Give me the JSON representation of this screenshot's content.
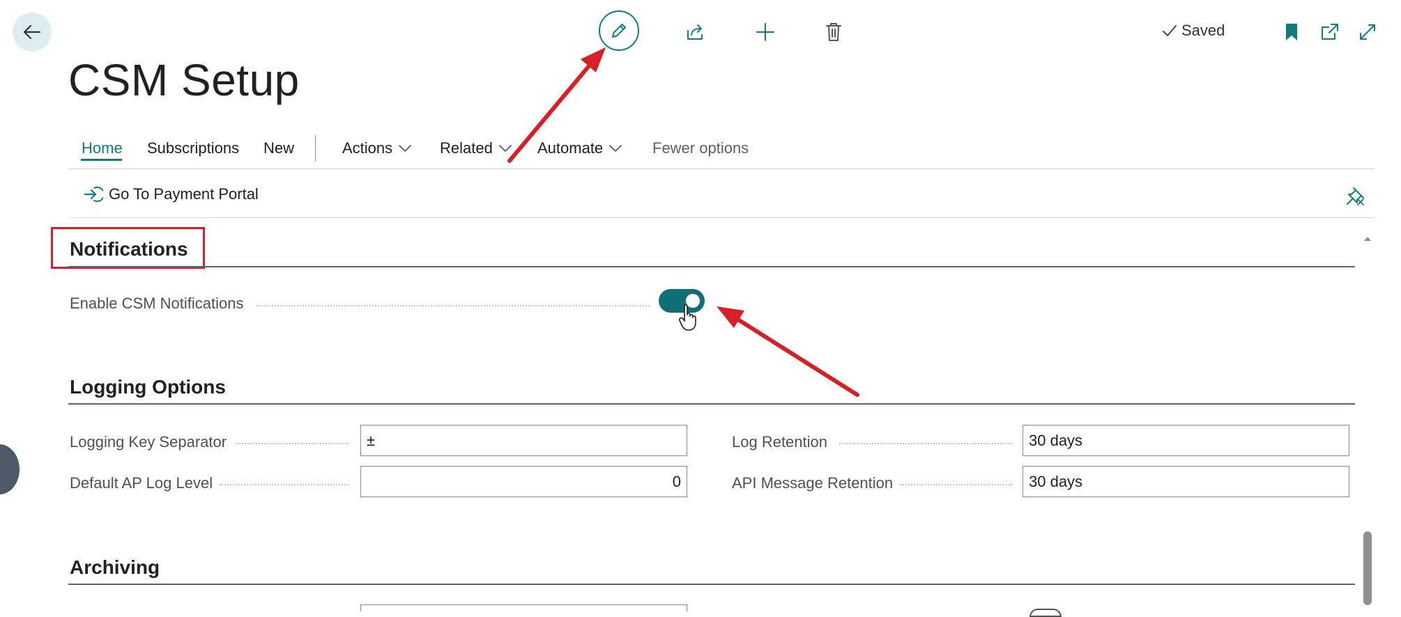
{
  "toolbar": {
    "back_icon": "arrow-left-icon",
    "edit_icon": "pencil-icon",
    "share_icon": "share-icon",
    "new_icon": "plus-icon",
    "delete_icon": "trash-icon",
    "saved_label": "Saved",
    "bookmark_icon": "bookmark-icon",
    "popout_icon": "open-in-new-window-icon",
    "expand_icon": "expand-icon"
  },
  "page": {
    "title": "CSM Setup"
  },
  "nav": {
    "home": "Home",
    "subscriptions": "Subscriptions",
    "new": "New",
    "actions": "Actions",
    "related": "Related",
    "automate": "Automate",
    "fewer_options": "Fewer options"
  },
  "actions_bar": {
    "portal_label": "Go To Payment Portal"
  },
  "sections": {
    "notifications": {
      "title": "Notifications",
      "enable_label": "Enable CSM Notifications",
      "enable_value": true
    },
    "logging": {
      "title": "Logging Options",
      "key_separator_label": "Logging Key Separator",
      "key_separator_value": "±",
      "log_level_label": "Default AP Log Level",
      "log_level_value": "0",
      "log_retention_label": "Log Retention",
      "log_retention_value": "30 days",
      "api_retention_label": "API Message Retention",
      "api_retention_value": "30 days"
    },
    "archiving": {
      "title": "Archiving"
    }
  },
  "colors": {
    "accent": "#107c7c",
    "toggle_on": "#0f6f77",
    "annotation": "#d61f26"
  }
}
